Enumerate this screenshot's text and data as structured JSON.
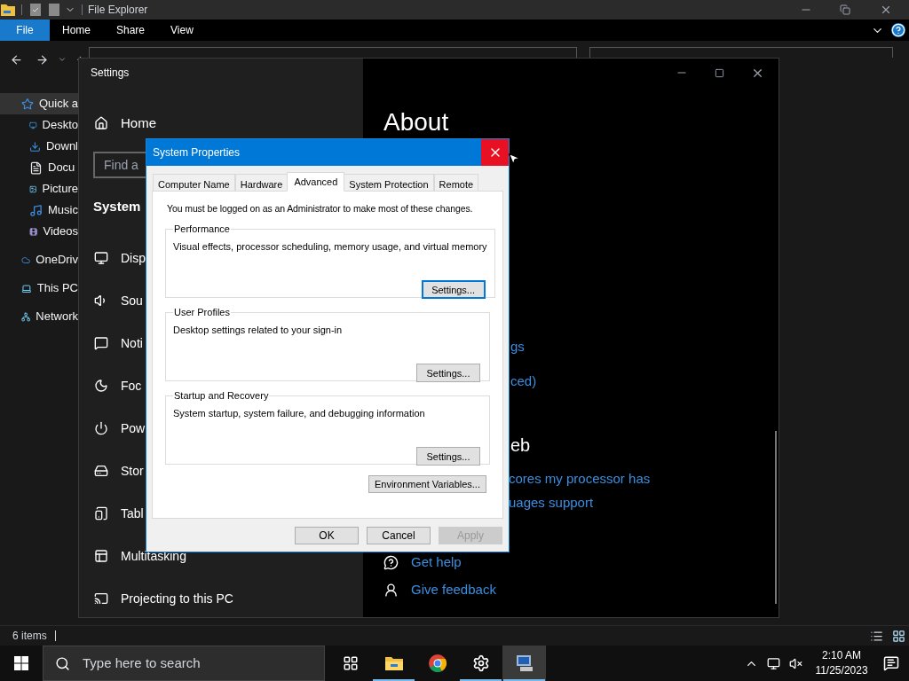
{
  "explorer": {
    "title": "File Explorer",
    "ribbon_tabs": [
      {
        "label": "File",
        "selected": true
      },
      {
        "label": "Home",
        "selected": false
      },
      {
        "label": "Share",
        "selected": false
      },
      {
        "label": "View",
        "selected": false
      }
    ],
    "nav_items": [
      {
        "label": "Quick a",
        "selected": true,
        "children": [
          {
            "label": "Deskto",
            "selected": false
          },
          {
            "label": "Downl",
            "selected": false
          },
          {
            "label": "Docu",
            "selected": false
          },
          {
            "label": "Picture",
            "selected": false
          },
          {
            "label": "Music",
            "selected": false
          },
          {
            "label": "Videos",
            "selected": false
          }
        ]
      },
      {
        "label": "OneDriv",
        "selected": false
      },
      {
        "label": "This PC",
        "selected": false
      },
      {
        "label": "Network",
        "selected": false
      }
    ],
    "status": "6 items"
  },
  "settings": {
    "title": "Settings",
    "home": "Home",
    "search_placeholder": "Find a",
    "section": "System",
    "nav_items": [
      {
        "label": "Disp"
      },
      {
        "label": "Sou"
      },
      {
        "label": "Noti"
      },
      {
        "label": "Foc"
      },
      {
        "label": "Pow"
      },
      {
        "label": "Stor"
      },
      {
        "label": "Tabl"
      },
      {
        "label": "Multitasking"
      },
      {
        "label": "Projecting to this PC"
      }
    ],
    "page_title": "About",
    "links_top": [
      "gs",
      "ced)"
    ],
    "heading": "eb",
    "links": [
      "cores my processor has",
      "uages support"
    ],
    "help_links": [
      {
        "label": "Get help"
      },
      {
        "label": "Give feedback"
      }
    ]
  },
  "dialog": {
    "title": "System Properties",
    "tabs": [
      {
        "label": "Computer Name",
        "selected": false
      },
      {
        "label": "Hardware",
        "selected": false
      },
      {
        "label": "Advanced",
        "selected": true
      },
      {
        "label": "System Protection",
        "selected": false
      },
      {
        "label": "Remote",
        "selected": false
      }
    ],
    "notice": "You must be logged on as an Administrator to make most of these changes.",
    "groups": [
      {
        "title": "Performance",
        "description": "Visual effects, processor scheduling, memory usage, and virtual memory",
        "button": "Settings...",
        "focused": true
      },
      {
        "title": "User Profiles",
        "description": "Desktop settings related to your sign-in",
        "button": "Settings...",
        "focused": false
      },
      {
        "title": "Startup and Recovery",
        "description": "System startup, system failure, and debugging information",
        "button": "Settings...",
        "focused": false
      }
    ],
    "env_button": "Environment Variables...",
    "buttons": [
      {
        "label": "OK",
        "disabled": false
      },
      {
        "label": "Cancel",
        "disabled": false
      },
      {
        "label": "Apply",
        "disabled": true
      }
    ]
  },
  "taskbar": {
    "search_placeholder": "Type here to search",
    "apps": [
      {
        "active": false,
        "selected": false
      },
      {
        "active": true,
        "selected": false
      },
      {
        "active": false,
        "selected": false
      },
      {
        "active": true,
        "selected": false
      },
      {
        "active": true,
        "selected": true
      }
    ],
    "time": "2:10 AM",
    "date": "11/25/2023"
  }
}
